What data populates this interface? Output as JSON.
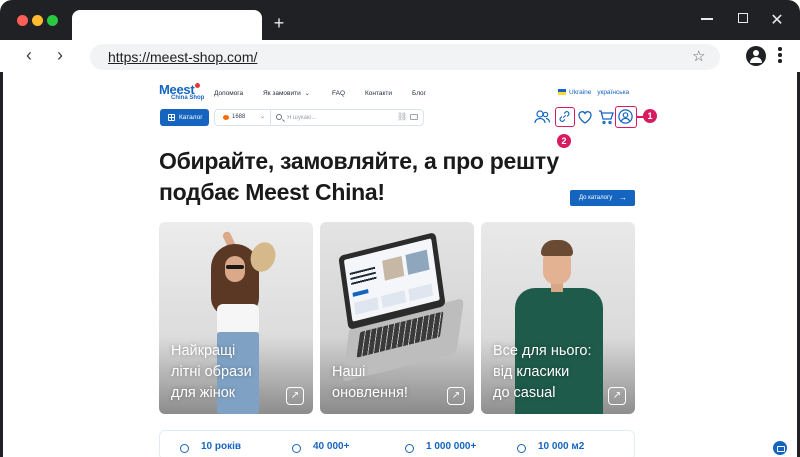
{
  "browser": {
    "url": "https://meest-shop.com/",
    "new_tab_label": "+",
    "back_glyph": "‹",
    "forward_glyph": "›",
    "star_glyph": "☆",
    "close_glyph": "✕"
  },
  "site": {
    "logo_main": "Meest",
    "logo_sub": "China Shop",
    "nav": [
      {
        "label": "Допомога"
      },
      {
        "label": "Як замовити"
      },
      {
        "label": "FAQ"
      },
      {
        "label": "Контакти"
      },
      {
        "label": "Блог"
      }
    ],
    "nav_chevron": "⌄",
    "country": "Ukraine",
    "language": "українська",
    "catalog_label": "Каталог",
    "source_selected": "1688",
    "search_placeholder": "Я шукаю...",
    "accent_color": "#1565c0",
    "highlight_color": "#d81b60"
  },
  "annotations": {
    "badge_1": "1",
    "badge_2": "2"
  },
  "hero": {
    "title_line_1": "Обирайте, замовляйте, а про решту",
    "title_line_2": "подбає Meest China!",
    "cta_label": "До каталогу",
    "cta_arrow": "→"
  },
  "cards": [
    {
      "title_line_1": "Найкращі",
      "title_line_2": "літні образи",
      "title_line_3": "для жінок",
      "arrow": "↗"
    },
    {
      "title_line_1": "Наші",
      "title_line_2": "оновлення!",
      "arrow": "↗"
    },
    {
      "title_line_1": "Все для нього:",
      "title_line_2": "від класики",
      "title_line_3": "до casual",
      "arrow": "↗"
    }
  ],
  "stats": [
    {
      "value": "10 років"
    },
    {
      "value": "40 000+"
    },
    {
      "value": "1 000 000+"
    },
    {
      "value": "10 000 м2"
    }
  ]
}
